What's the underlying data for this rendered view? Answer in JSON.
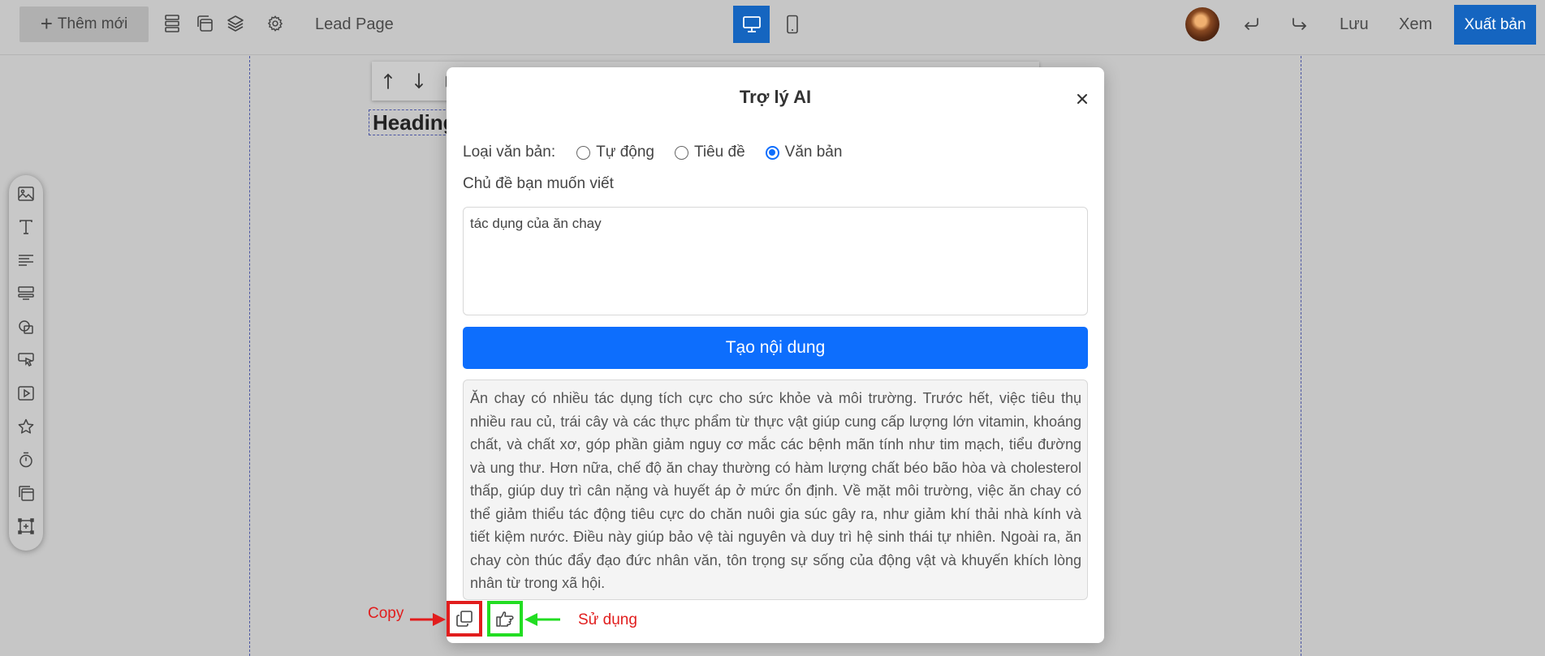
{
  "toolbar": {
    "add_label": "Thêm mới",
    "page_name": "Lead Page",
    "save_label": "Lưu",
    "preview_label": "Xem",
    "publish_label": "Xuất bản",
    "icons": [
      "sections-icon",
      "popup-icon",
      "layers-icon",
      "settings-icon",
      "desktop-view-icon",
      "mobile-view-icon",
      "undo-icon",
      "redo-icon"
    ],
    "active_view": "desktop"
  },
  "canvas": {
    "heading_text": "Heading",
    "element_toolbar_icons": [
      "move-up-icon",
      "move-down-icon",
      "duplicate-icon"
    ]
  },
  "sidebar": {
    "items": [
      "image-icon",
      "text-icon",
      "paragraph-icon",
      "form-icon",
      "shape-icon",
      "button-icon",
      "video-icon",
      "star-icon",
      "countdown-icon",
      "gallery-icon",
      "frame-icon"
    ]
  },
  "modal": {
    "title": "Trợ lý AI",
    "type_label": "Loại văn bản:",
    "types": [
      "Tự động",
      "Tiêu đề",
      "Văn bản"
    ],
    "selected_type": "Văn bản",
    "topic_label": "Chủ đề bạn muốn viết",
    "topic_value": "tác dụng của ăn chay",
    "generate_label": "Tạo nội dung",
    "result_text": "Ăn chay có nhiều tác dụng tích cực cho sức khỏe và môi trường. Trước hết, việc tiêu thụ nhiều rau củ, trái cây và các thực phẩm từ thực vật giúp cung cấp lượng lớn vitamin, khoáng chất, và chất xơ, góp phần giảm nguy cơ mắc các bệnh mãn tính như tim mạch, tiểu đường và ung thư. Hơn nữa, chế độ ăn chay thường có hàm lượng chất béo bão hòa và cholesterol thấp, giúp duy trì cân nặng và huyết áp ở mức ổn định. Về mặt môi trường, việc ăn chay có thể giảm thiểu tác động tiêu cực do chăn nuôi gia súc gây ra, như giảm khí thải nhà kính và tiết kiệm nước. Điều này giúp bảo vệ tài nguyên và duy trì hệ sinh thái tự nhiên. Ngoài ra, ăn chay còn thúc đẩy đạo đức nhân văn, tôn trọng sự sống của động vật và khuyến khích lòng nhân từ trong xã hội."
  },
  "annotations": {
    "copy_label": "Copy",
    "use_label": "Sử dụng",
    "copy_color": "#e11d1d",
    "use_color": "#22dd22"
  },
  "colors": {
    "brand": "#1565c0",
    "primary": "#0d6efd",
    "overlay": "#c6c6c6"
  }
}
